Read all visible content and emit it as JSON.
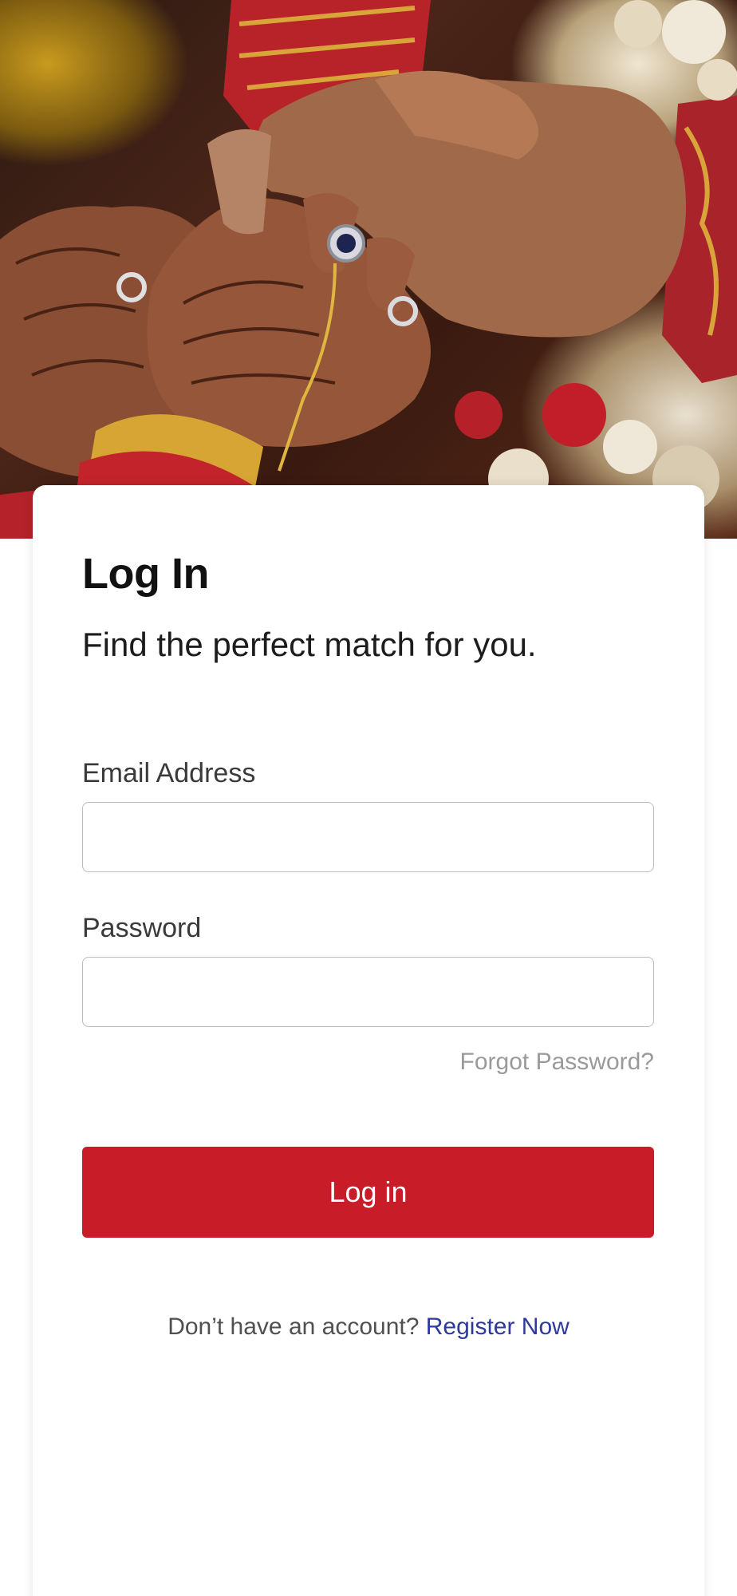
{
  "login": {
    "title": "Log In",
    "subtitle": "Find the perfect match for you.",
    "email_label": "Email Address",
    "email_value": "",
    "password_label": "Password",
    "password_value": "",
    "forgot_password": "Forgot Password?",
    "login_button": "Log in",
    "register_prompt": "Don’t have an account?",
    "register_link": "Register Now"
  },
  "colors": {
    "primary": "#c81c28",
    "link": "#2d3a9c",
    "muted": "#9a9a9a"
  }
}
